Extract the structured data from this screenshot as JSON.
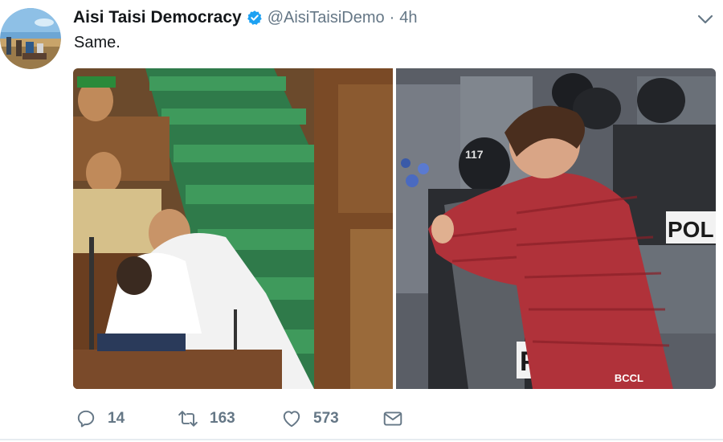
{
  "author": {
    "display_name": "Aisi Taisi Democracy",
    "handle": "@AisiTaisiDemo",
    "separator": "·",
    "time": "4h",
    "verified_icon": "verified-badge-icon",
    "avatar_icon": "profile-avatar"
  },
  "tweet": {
    "text": "Same.",
    "media_watermark": "BCCL"
  },
  "actions": {
    "reply_count": "14",
    "retweet_count": "163",
    "like_count": "573"
  },
  "colors": {
    "text": "#14171a",
    "muted": "#657786",
    "verified_blue": "#1da1f2"
  }
}
